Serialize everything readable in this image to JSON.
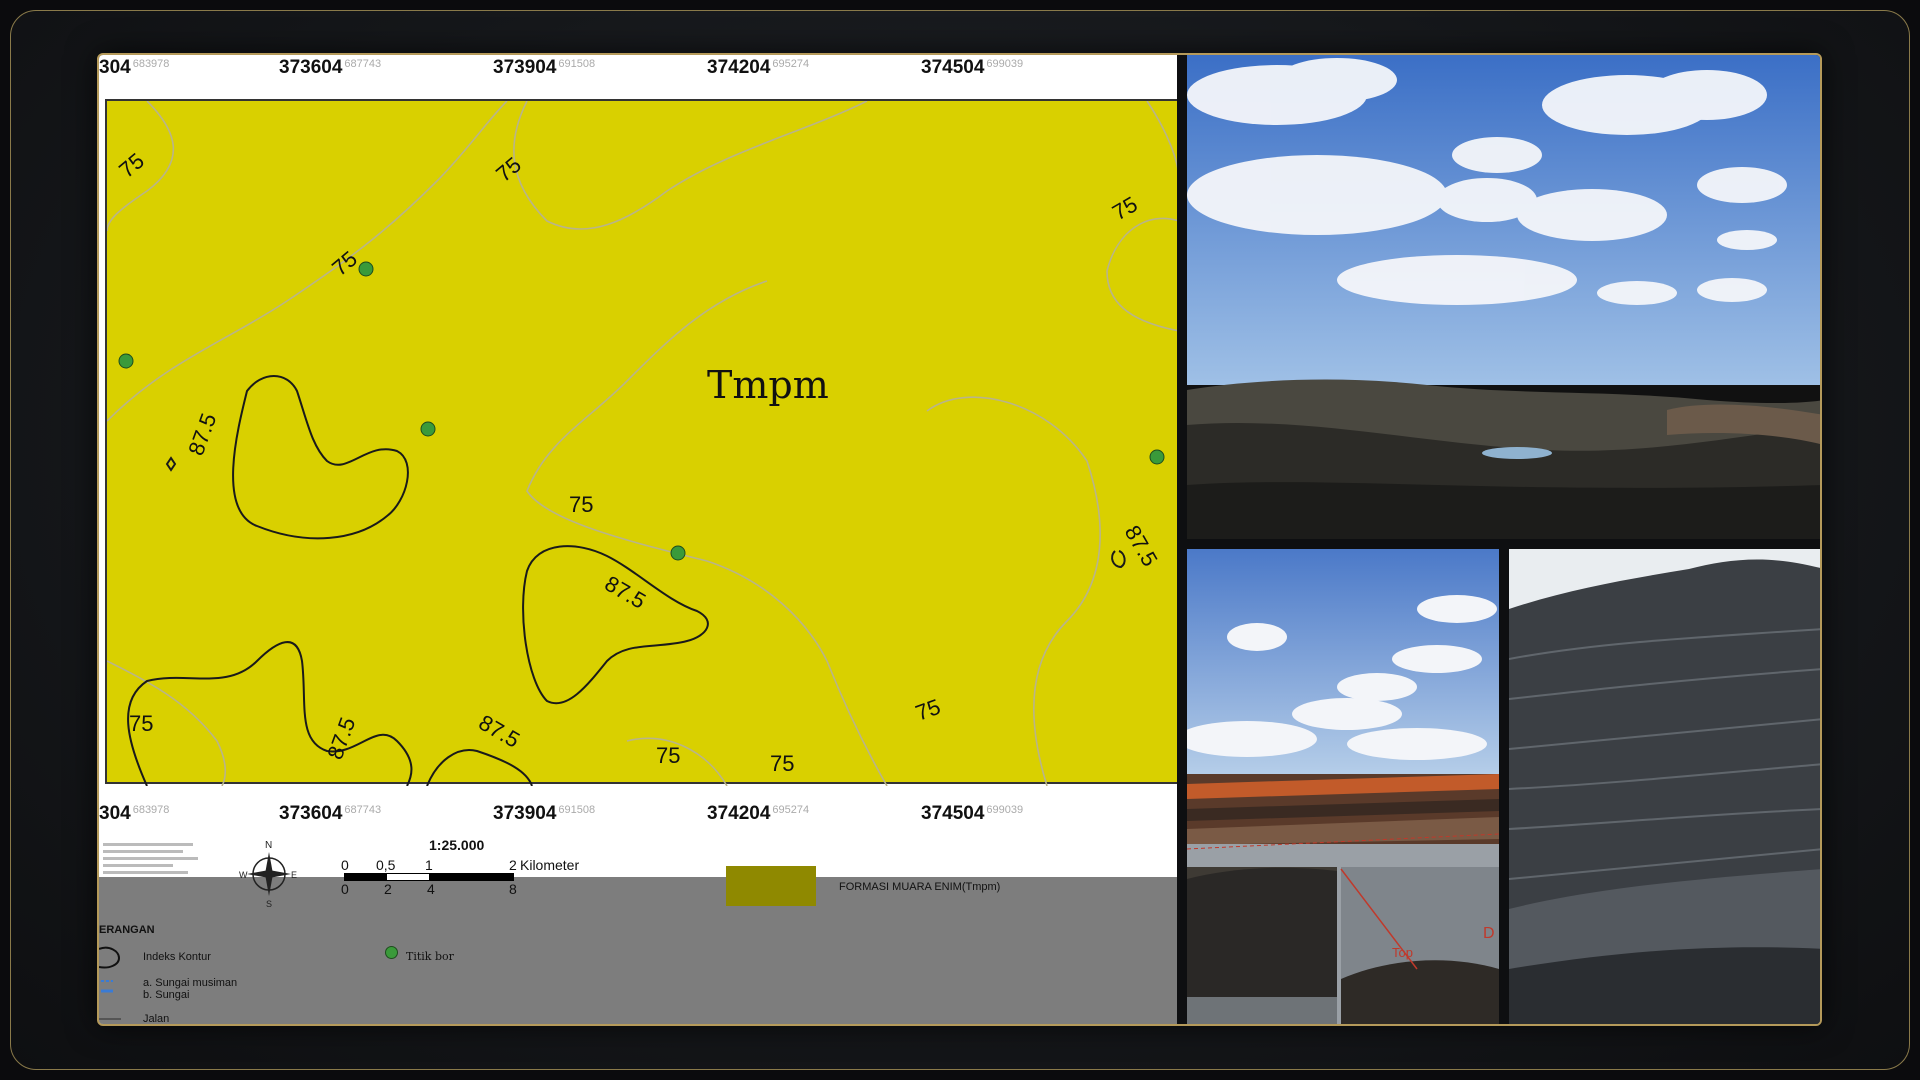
{
  "map": {
    "coords_top": [
      {
        "main": "304",
        "sub": "683978"
      },
      {
        "main": "373604",
        "sub": "687743"
      },
      {
        "main": "373904",
        "sub": "691508"
      },
      {
        "main": "374204",
        "sub": "695274"
      },
      {
        "main": "374504",
        "sub": "699039"
      }
    ],
    "coords_bottom": [
      {
        "main": "304",
        "sub": "683978"
      },
      {
        "main": "373604",
        "sub": "687743"
      },
      {
        "main": "373904",
        "sub": "691508"
      },
      {
        "main": "374204",
        "sub": "695274"
      },
      {
        "main": "374504",
        "sub": "699039"
      }
    ],
    "formation_code": "Tmpm",
    "contour_labels": [
      "75",
      "75",
      "75",
      "75",
      "87.5",
      "75",
      "87.5",
      "87.5",
      "75",
      "87.5",
      "87.5",
      "75",
      "75",
      "75"
    ],
    "scale": {
      "ratio": "1:25.000",
      "top_ticks": [
        "0",
        "0,5",
        "1",
        "2"
      ],
      "unit": "Kilometer",
      "bottom_ticks": [
        "0",
        "2",
        "4",
        "8"
      ]
    },
    "compass_letters": {
      "n": "N",
      "s": "S",
      "e": "E",
      "w": "W"
    },
    "legend": {
      "formation_label": "FORMASI MUARA ENIM(Tmpm)",
      "heading": "ERANGAN",
      "contour_index": "Indeks Kontur",
      "river_a": "a. Sungai musiman",
      "river_b": "b. Sungai",
      "road": "Jalan",
      "drill_point": "Titik bor"
    },
    "colors": {
      "formation_fill": "#d9d000",
      "drill_point": "#3a9a3a",
      "legend_swatch": "#8f8900"
    }
  },
  "photos": {
    "top": "open-pit-mine-panorama",
    "bottom_left": "mine-highwall-view",
    "bottom_right": "coal-stockpile-closeup",
    "bottom_left_labels": [
      "Top",
      "D"
    ]
  }
}
